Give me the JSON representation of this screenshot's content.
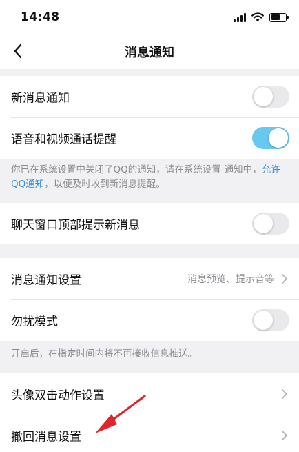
{
  "status_bar": {
    "time": "14:48"
  },
  "nav": {
    "title": "消息通知"
  },
  "rows": {
    "new_message": {
      "label": "新消息通知",
      "toggle_on": false
    },
    "call_reminder": {
      "label": "语音和视频通话提醒",
      "toggle_on": true
    },
    "top_prompt": {
      "label": "聊天窗口顶部提示新消息",
      "toggle_on": false
    },
    "notify_settings": {
      "label": "消息通知设置",
      "value": "消息预览、提示音等"
    },
    "dnd": {
      "label": "勿扰模式",
      "toggle_on": false
    },
    "avatar_double_tap": {
      "label": "头像双击动作设置"
    },
    "recall": {
      "label": "撤回消息设置"
    }
  },
  "hints": {
    "system_notice_pre": "你已在系统设置中关闭了QQ的通知，请在系统设置-通知中，",
    "system_notice_link": "允许QQ通知",
    "system_notice_post": "，以便及时收到新消息提醒。",
    "dnd_notice": "开启后，在指定时间内将不再接收信息推送。"
  },
  "colors": {
    "toggle_on": "#68c9f0",
    "link": "#2f8fe0",
    "annotation_arrow": "#e0262b"
  },
  "icons": {
    "back": "chevron-left-icon",
    "row_arrow": "chevron-right-icon"
  }
}
